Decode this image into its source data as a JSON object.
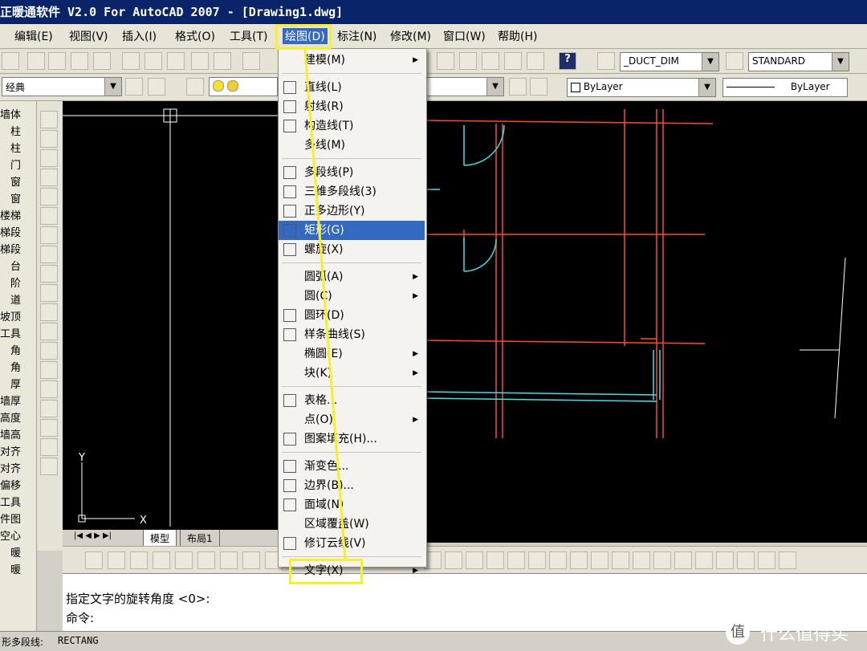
{
  "window": {
    "title": "正暖通软件 V2.0 For AutoCAD 2007 - [Drawing1.dwg]"
  },
  "menubar": {
    "items": [
      "编辑(E)",
      "视图(V)",
      "插入(I)",
      "格式(O)",
      "工具(T)",
      "绘图(D)",
      "标注(N)",
      "修改(M)",
      "窗口(W)",
      "帮助(H)"
    ]
  },
  "toolbar": {
    "workspace": "经典",
    "dimstyle": "_DUCT_DIM",
    "textstyle": "STANDARD",
    "color": "ByLayer",
    "linetype": "ByLayer"
  },
  "left_panel": {
    "items": [
      "墙体",
      "柱",
      "柱",
      "门",
      "窗",
      "窗",
      "楼梯",
      "梯段",
      "梯段",
      "台",
      "阶",
      "道",
      "坡顶",
      "工具",
      "角",
      "角",
      "厚",
      "墙厚",
      "高度",
      "墙高",
      "对齐",
      "对齐",
      "偏移",
      "工具",
      "件图",
      "空心",
      "暖",
      "暖"
    ]
  },
  "dropdown": {
    "items": [
      {
        "label": "建模(M)",
        "submenu": true,
        "icon": ""
      },
      {
        "sep": true
      },
      {
        "label": "直线(L)",
        "icon": "line-icon"
      },
      {
        "label": "射线(R)",
        "icon": "ray-icon"
      },
      {
        "label": "构造线(T)",
        "icon": "xline-icon"
      },
      {
        "label": "多线(M)",
        "icon": ""
      },
      {
        "sep": true
      },
      {
        "label": "多段线(P)",
        "icon": "polyline-icon"
      },
      {
        "label": "三维多段线(3)",
        "icon": "3dpoly-icon"
      },
      {
        "label": "正多边形(Y)",
        "icon": "polygon-icon"
      },
      {
        "label": "矩形(G)",
        "icon": "rectangle-icon",
        "highlight": true
      },
      {
        "label": "螺旋(X)",
        "icon": "helix-icon"
      },
      {
        "sep": true
      },
      {
        "label": "圆弧(A)",
        "submenu": true,
        "icon": ""
      },
      {
        "label": "圆(C)",
        "submenu": true,
        "icon": ""
      },
      {
        "label": "圆环(D)",
        "icon": "donut-icon"
      },
      {
        "label": "样条曲线(S)",
        "icon": "spline-icon"
      },
      {
        "label": "椭圆(E)",
        "submenu": true,
        "icon": ""
      },
      {
        "label": "块(K)",
        "submenu": true,
        "icon": ""
      },
      {
        "sep": true
      },
      {
        "label": "表格...",
        "icon": "table-icon"
      },
      {
        "label": "点(O)",
        "submenu": true,
        "icon": ""
      },
      {
        "label": "图案填充(H)...",
        "icon": "hatch-icon"
      },
      {
        "sep": true
      },
      {
        "label": "渐变色...",
        "icon": "gradient-icon"
      },
      {
        "label": "边界(B)...",
        "icon": "boundary-icon"
      },
      {
        "label": "面域(N)",
        "icon": "region-icon"
      },
      {
        "label": "区域覆盖(W)",
        "icon": ""
      },
      {
        "label": "修订云线(V)",
        "icon": "revcloud-icon"
      },
      {
        "sep": true
      },
      {
        "label": "文字(X)",
        "submenu": true,
        "icon": ""
      }
    ]
  },
  "tabs": [
    "模型",
    "布局1"
  ],
  "command": {
    "line1": "指定文字的旋转角度 <0>:",
    "line2": "命令:"
  },
  "status": {
    "left": "形多段线:",
    "right": "RECTANG"
  },
  "watermark": {
    "text": "什么值得买",
    "icon": "值"
  },
  "colors": {
    "title_bg": "#0a246a",
    "highlight": "#3469c2",
    "annotation": "#f5f02a",
    "cad_red": "#ff4a2a",
    "cad_cyan": "#3fe0ea",
    "cad_white": "#ffffff"
  }
}
